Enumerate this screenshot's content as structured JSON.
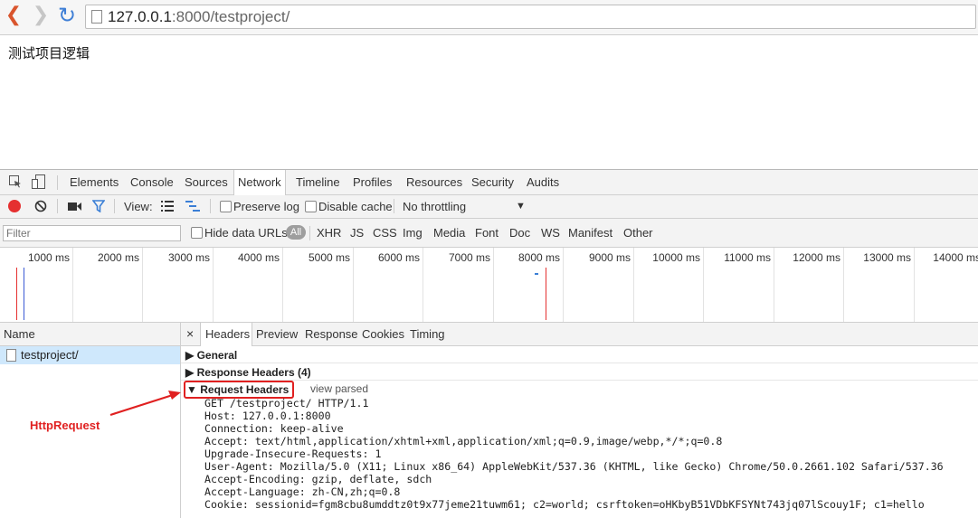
{
  "browser": {
    "url_host": "127.0.0.1",
    "url_rest": ":8000/testproject/"
  },
  "page": {
    "text": "测试项目逻辑"
  },
  "devtools": {
    "tabs": [
      "Elements",
      "Console",
      "Sources",
      "Network",
      "Timeline",
      "Profiles",
      "Resources",
      "Security",
      "Audits"
    ],
    "active_tab": "Network",
    "toolbar": {
      "view_label": "View:",
      "preserve_log": "Preserve log",
      "disable_cache": "Disable cache",
      "throttling": "No throttling"
    },
    "filter": {
      "placeholder": "Filter",
      "hide_data_urls": "Hide data URLs",
      "types": [
        "All",
        "XHR",
        "JS",
        "CSS",
        "Img",
        "Media",
        "Font",
        "Doc",
        "WS",
        "Manifest",
        "Other"
      ]
    },
    "timeline_ticks": [
      "1000 ms",
      "2000 ms",
      "3000 ms",
      "4000 ms",
      "5000 ms",
      "6000 ms",
      "7000 ms",
      "8000 ms",
      "9000 ms",
      "10000 ms",
      "11000 ms",
      "12000 ms",
      "13000 ms",
      "14000 ms"
    ],
    "name_column": {
      "header": "Name",
      "rows": [
        "testproject/"
      ]
    },
    "detail": {
      "close": "×",
      "tabs": [
        "Headers",
        "Preview",
        "Response",
        "Cookies",
        "Timing"
      ],
      "active_tab": "Headers",
      "sections": {
        "general": "General",
        "response_headers": "Response Headers (4)",
        "request_headers": "Request Headers",
        "view_parsed": "view parsed"
      },
      "request_lines": [
        "GET /testproject/ HTTP/1.1",
        "Host: 127.0.0.1:8000",
        "Connection: keep-alive",
        "Accept: text/html,application/xhtml+xml,application/xml;q=0.9,image/webp,*/*;q=0.8",
        "Upgrade-Insecure-Requests: 1",
        "User-Agent: Mozilla/5.0 (X11; Linux x86_64) AppleWebKit/537.36 (KHTML, like Gecko) Chrome/50.0.2661.102 Safari/537.36",
        "Accept-Encoding: gzip, deflate, sdch",
        "Accept-Language: zh-CN,zh;q=0.8",
        "Cookie: sessionid=fgm8cbu8umddtz0t9x77jeme21tuwm61; c2=world; csrftoken=oHKbyB51VDbKFSYNt743jq07lScouy1F; c1=hello"
      ]
    },
    "annotation": {
      "label": "HttpRequest",
      "color": "#e02020"
    }
  }
}
